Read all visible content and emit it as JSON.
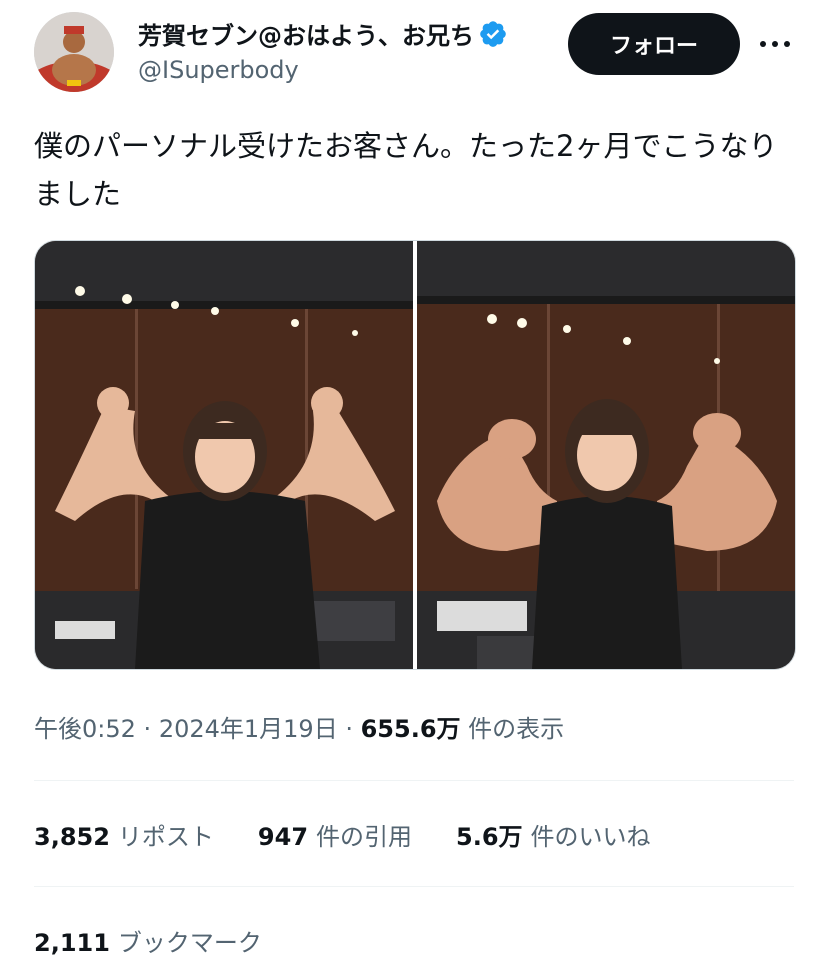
{
  "author": {
    "display_name": "芳賀セブン@おはよう、お兄ち",
    "handle": "@ISuperbody",
    "avatar_icon": "avatar-bodybuilder",
    "verified_icon": "verified-badge-icon"
  },
  "header": {
    "follow_label": "フォロー",
    "more_icon": "more-icon"
  },
  "tweet": {
    "text": "僕のパーソナル受けたお客さん。たった2ヶ月でこうなりました"
  },
  "media": [
    {
      "icon": "photo-before"
    },
    {
      "icon": "photo-after"
    }
  ],
  "meta": {
    "time": "午後0:52",
    "date": "2024年1月19日",
    "views_count": "655.6万",
    "views_label": "件の表示"
  },
  "stats": {
    "reposts": {
      "count": "3,852",
      "label": "リポスト"
    },
    "quotes": {
      "count": "947",
      "label": "件の引用"
    },
    "likes": {
      "count": "5.6万",
      "label": "件のいいね"
    },
    "bookmarks": {
      "count": "2,111",
      "label": "ブックマーク"
    }
  },
  "colors": {
    "text": "#0f1419",
    "secondary": "#536471",
    "verified": "#1d9bf0",
    "follow_bg": "#0f1419",
    "divider": "#eff3f4"
  }
}
